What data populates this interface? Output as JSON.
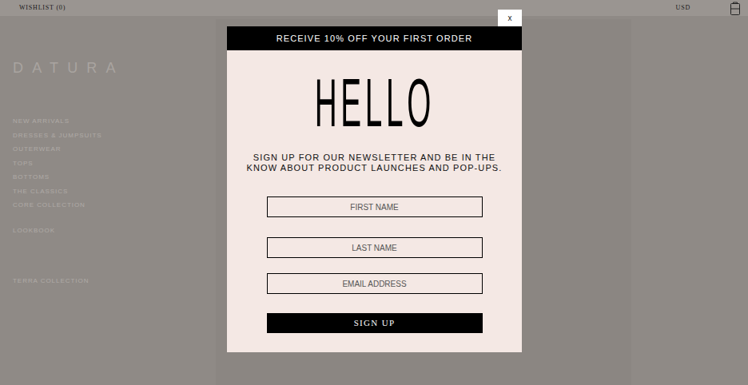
{
  "header": {
    "wishlist": "WISHLIST (0)",
    "currency": "USD"
  },
  "brand": "DATURA",
  "nav": [
    {
      "label": "NEW ARRIVALS",
      "group": 1
    },
    {
      "label": "DRESSES & JUMPSUITS",
      "group": 1
    },
    {
      "label": "OUTERWEAR",
      "group": 1
    },
    {
      "label": "TOPS",
      "group": 1
    },
    {
      "label": "BOTTOMS",
      "group": 1
    },
    {
      "label": "THE CLASSICS",
      "group": 1
    },
    {
      "label": "CORE COLLECTION",
      "group": 1
    },
    {
      "label": "LOOKBOOK",
      "group": 2
    },
    {
      "label": "TERRA COLLECTION",
      "group": 3
    }
  ],
  "modal": {
    "close": "x",
    "banner": "RECEIVE 10% OFF YOUR FIRST ORDER",
    "title": "HELLO",
    "message": "SIGN UP FOR OUR NEWSLETTER AND BE IN THE KNOW ABOUT PRODUCT LAUNCHES AND POP-UPS.",
    "fields": [
      {
        "placeholder": "FIRST NAME"
      },
      {
        "placeholder": "LAST NAME"
      },
      {
        "placeholder": "EMAIL ADDRESS"
      }
    ],
    "submit": "SIGN UP"
  }
}
